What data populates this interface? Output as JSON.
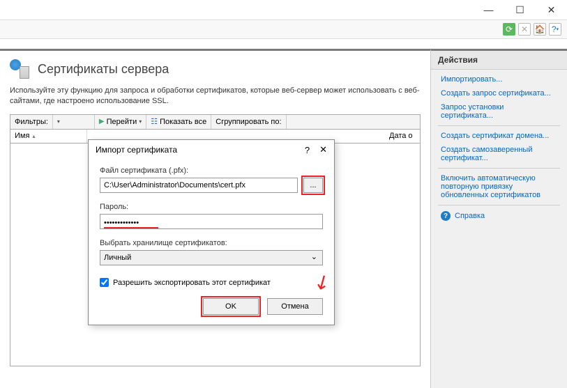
{
  "page": {
    "title": "Сертификаты сервера",
    "description": "Используйте эту функцию для запроса и обработки сертификатов, которые веб-сервер может использовать с веб-сайтами, где настроено использование SSL."
  },
  "filterbar": {
    "filter_label": "Фильтры:",
    "go_label": "Перейти",
    "show_all_label": "Показать все",
    "group_by_label": "Сгруппировать по:"
  },
  "columns": {
    "name": "Имя",
    "issued_to": "Дата о"
  },
  "actions": {
    "header": "Действия",
    "import": "Импортировать...",
    "create_request": "Создать запрос сертификата...",
    "install_request": "Запрос установки сертификата...",
    "create_domain": "Создать сертификат домена...",
    "create_selfsigned": "Создать самозаверенный сертификат...",
    "auto_rebind": "Включить автоматическую повторную привязку обновленных сертификатов",
    "help": "Справка"
  },
  "dialog": {
    "title": "Импорт сертификата",
    "file_label": "Файл сертификата (.pfx):",
    "file_value": "C:\\User\\Administrator\\Documents\\cert.pfx",
    "browse": "...",
    "password_label": "Пароль:",
    "password_value": "•••••••••••••",
    "store_label": "Выбрать хранилище сертификатов:",
    "store_value": "Личный",
    "allow_export": "Разрешить экспортировать этот сертификат",
    "ok": "OK",
    "cancel": "Отмена"
  }
}
